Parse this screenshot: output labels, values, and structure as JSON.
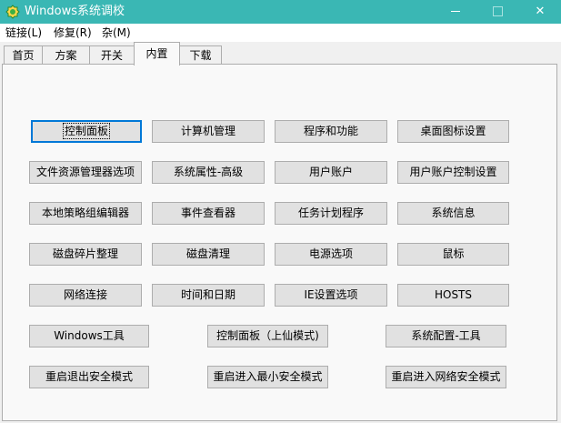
{
  "window": {
    "title": "Windows系统调校",
    "accent_color": "#3ab7b4",
    "icons": {
      "app": "app-icon",
      "minimize": "minimize-icon",
      "maximize": "maximize-icon",
      "close": "close-icon"
    },
    "close_glyph": "✕"
  },
  "menu": {
    "items": [
      "链接(L)",
      "修复(R)",
      "杂(M)"
    ]
  },
  "tabs": {
    "items": [
      "首页",
      "方案",
      "开关",
      "内置",
      "下载"
    ],
    "active": "内置"
  },
  "buttons": {
    "rows": [
      [
        "控制面板",
        "计算机管理",
        "程序和功能",
        "桌面图标设置"
      ],
      [
        "文件资源管理器选项",
        "系统属性-高级",
        "用户账户",
        "用户账户控制设置"
      ],
      [
        "本地策略组编辑器",
        "事件查看器",
        "任务计划程序",
        "系统信息"
      ],
      [
        "磁盘碎片整理",
        "磁盘清理",
        "电源选项",
        "鼠标"
      ],
      [
        "网络连接",
        "时间和日期",
        "IE设置选项",
        "HOSTS"
      ],
      [
        "Windows工具",
        "控制面板（上仙模式)",
        "系统配置-工具"
      ],
      [
        "重启退出安全模式",
        "重启进入最小安全模式",
        "重启进入网络安全模式"
      ]
    ]
  }
}
